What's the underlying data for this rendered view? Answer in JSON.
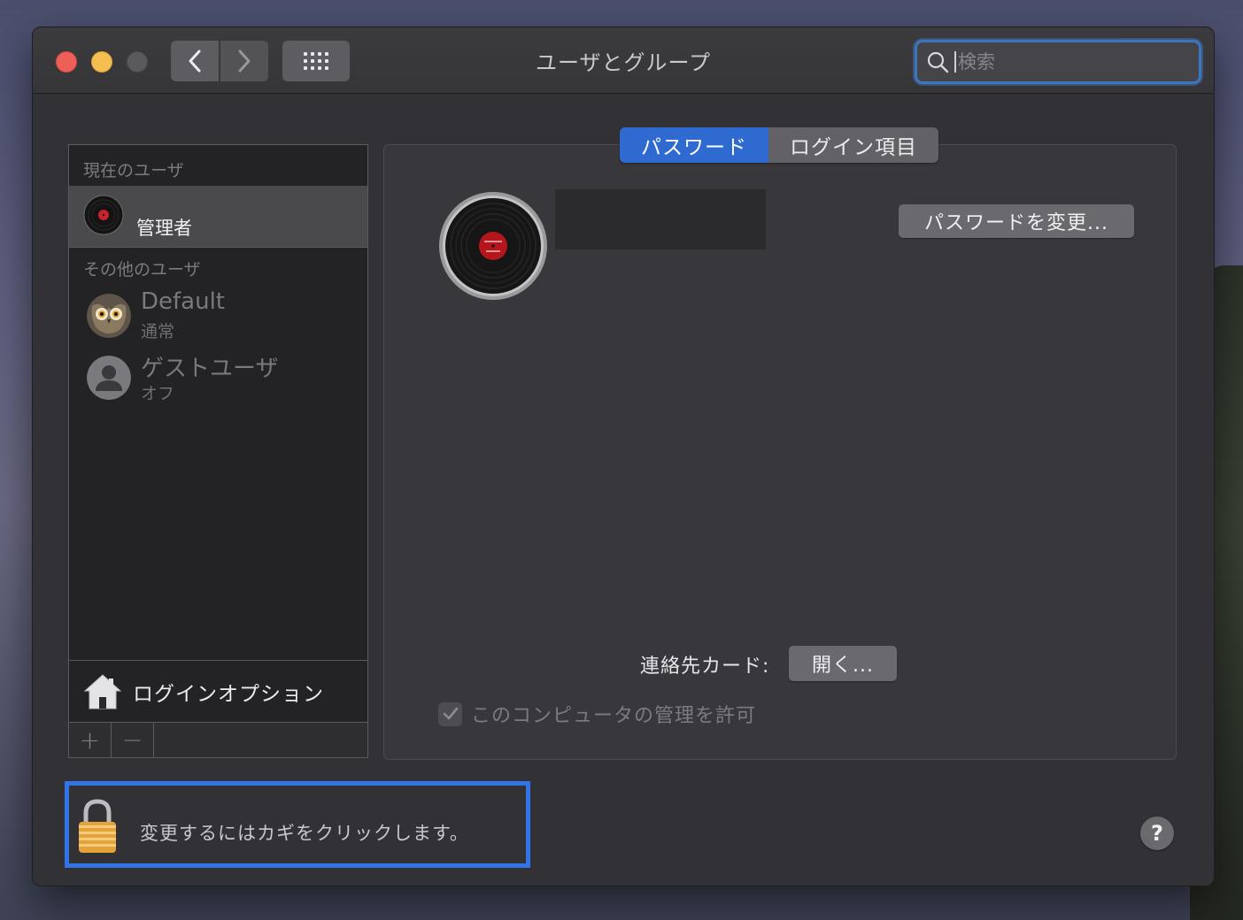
{
  "window": {
    "title": "ユーザとグループ",
    "search_placeholder": "検索"
  },
  "toolbar": {
    "back_icon": "chevron-left-icon",
    "forward_icon": "chevron-right-icon",
    "show_all_icon": "grid-icon"
  },
  "sidebar": {
    "current_users_header": "現在のユーザ",
    "current_user": {
      "name": "管理者",
      "avatar": "vinyl-record-avatar"
    },
    "other_users_header": "その他のユーザ",
    "other_users": [
      {
        "name": "Default",
        "status": "通常",
        "avatar": "owl-avatar"
      },
      {
        "name": "ゲストユーザ",
        "status": "オフ",
        "avatar": "person-silhouette-avatar"
      }
    ],
    "login_options_label": "ログインオプション",
    "add_label": "+",
    "remove_label": "−"
  },
  "tabs": [
    {
      "label": "パスワード",
      "selected": true
    },
    {
      "label": "ログイン項目",
      "selected": false
    }
  ],
  "detail": {
    "change_password_button": "パスワードを変更...",
    "contact_card_label": "連絡先カード:",
    "open_button": "開く...",
    "allow_admin_label": "このコンピュータの管理を許可",
    "allow_admin_checked": true,
    "allow_admin_enabled": false
  },
  "footer": {
    "lock_text": "変更するにはカギをクリックします。",
    "help_label": "?"
  },
  "colors": {
    "accent": "#2f6ad1",
    "highlight_border": "#2f75e8",
    "window_bg": "#323236"
  }
}
